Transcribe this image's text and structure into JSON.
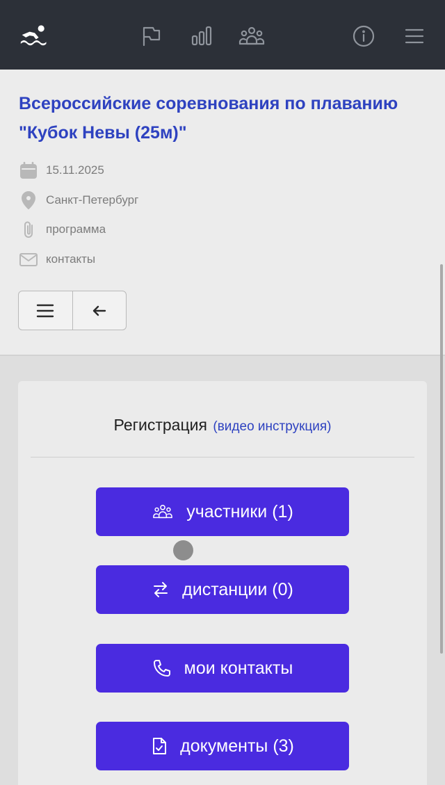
{
  "nav": {
    "icons": [
      "swimmer-logo-icon",
      "flag-icon",
      "bar-chart-icon",
      "users-icon",
      "info-icon",
      "menu-icon"
    ]
  },
  "event": {
    "title": "Всероссийские соревнования по плаванию \"Кубок Невы (25м)\"",
    "date": "15.11.2025",
    "location": "Санкт-Петербург",
    "program": "программа",
    "contacts": "контакты"
  },
  "registration": {
    "heading": "Регистрация",
    "video_link": "(видео инструкция)",
    "buttons": {
      "participants": "участники (1)",
      "distances": "дистанции (0)",
      "my_contacts": "мои контакты",
      "documents": "документы (3)"
    }
  },
  "colors": {
    "topbar": "#2c3038",
    "accent_title": "#2e42c0",
    "action_button": "#4a2be0"
  }
}
